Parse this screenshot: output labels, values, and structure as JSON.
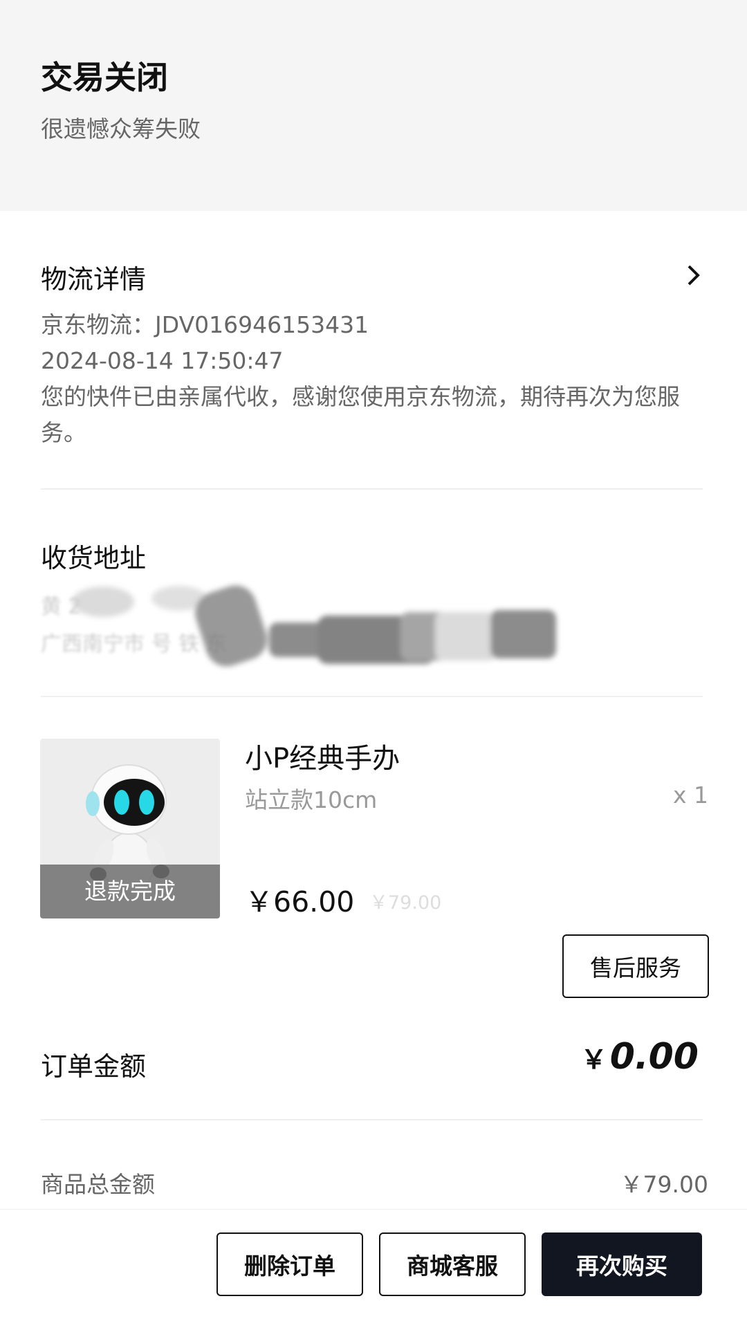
{
  "status": {
    "title": "交易关闭",
    "subtitle": "很遗憾众筹失败"
  },
  "logistics": {
    "title": "物流详情",
    "carrier_line": "京东物流：JDV016946153431",
    "timestamp": "2024-08-14 17:50:47",
    "message": "您的快件已由亲属代收，感谢您使用京东物流，期待再次为您服务。"
  },
  "address": {
    "title": "收货地址",
    "line1": "黄 2",
    "line2": "广西南宁市 号 铁 东"
  },
  "product": {
    "thumb_overlay": "退款完成",
    "name": "小P经典手办",
    "spec": "站立款10cm",
    "qty": "x 1",
    "price": "￥66.00",
    "original_price": "￥79.00",
    "after_sale_label": "售后服务"
  },
  "order": {
    "amount_label": "订单金额",
    "amount_currency": "￥",
    "amount_value": "0.00",
    "goods_total_label": "商品总金额",
    "goods_total_value": "￥79.00"
  },
  "actions": {
    "delete_label": "删除订单",
    "service_label": "商城客服",
    "rebuy_label": "再次购买"
  },
  "colors": {
    "primary_dark": "#121620",
    "header_bg": "#f5f5f5",
    "robot_eye": "#27d9e6"
  },
  "icons": {
    "logistics_arrow": "chevron-right-icon"
  }
}
